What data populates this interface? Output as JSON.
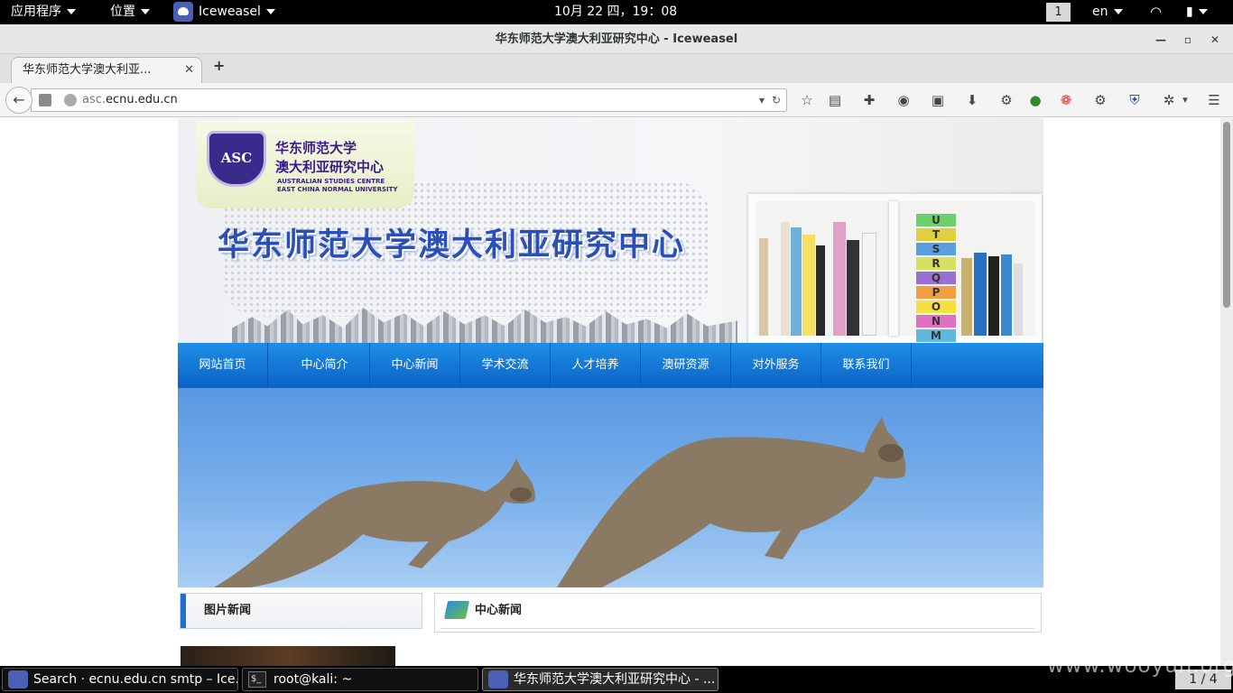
{
  "topbar": {
    "applications": "应用程序",
    "places": "位置",
    "active_app": "Iceweasel",
    "clock": "10月 22 四，19：08",
    "workspace": "1",
    "language": "en"
  },
  "window": {
    "title": "华东师范大学澳大利亚研究中心 - Iceweasel",
    "minimize": "—",
    "maximize": "▫",
    "close": "✕"
  },
  "tab": {
    "label": "华东师范大学澳大利亚...",
    "close": "✕",
    "new": "+"
  },
  "navbar": {
    "url_prefix": "asc.",
    "url_domain": "ecnu.edu.cn"
  },
  "page": {
    "logo_cn_line1": "华东师范大学",
    "logo_cn_line2": "澳大利亚研究中心",
    "logo_en_line1": "AUSTRALIAN STUDIES CENTRE",
    "logo_en_line2": "EAST CHINA NORMAL UNIVERSITY",
    "seal_letters": "ASC",
    "banner_title": "华东师范大学澳大利亚研究中心",
    "menu": [
      "网站首页",
      "中心简介",
      "中心新闻",
      "学术交流",
      "人才培养",
      "澳研资源",
      "对外服务",
      "联系我们"
    ],
    "left_panel_title": "图片新闻",
    "right_panel_title": "中心新闻"
  },
  "taskbar": {
    "items": [
      "Search · ecnu.edu.cn smtp – Ice...",
      "root@kali: ~",
      "华东师范大学澳大利亚研究中心 - ..."
    ],
    "pager": "1 / 4"
  },
  "watermark": "www.wooyun.org"
}
